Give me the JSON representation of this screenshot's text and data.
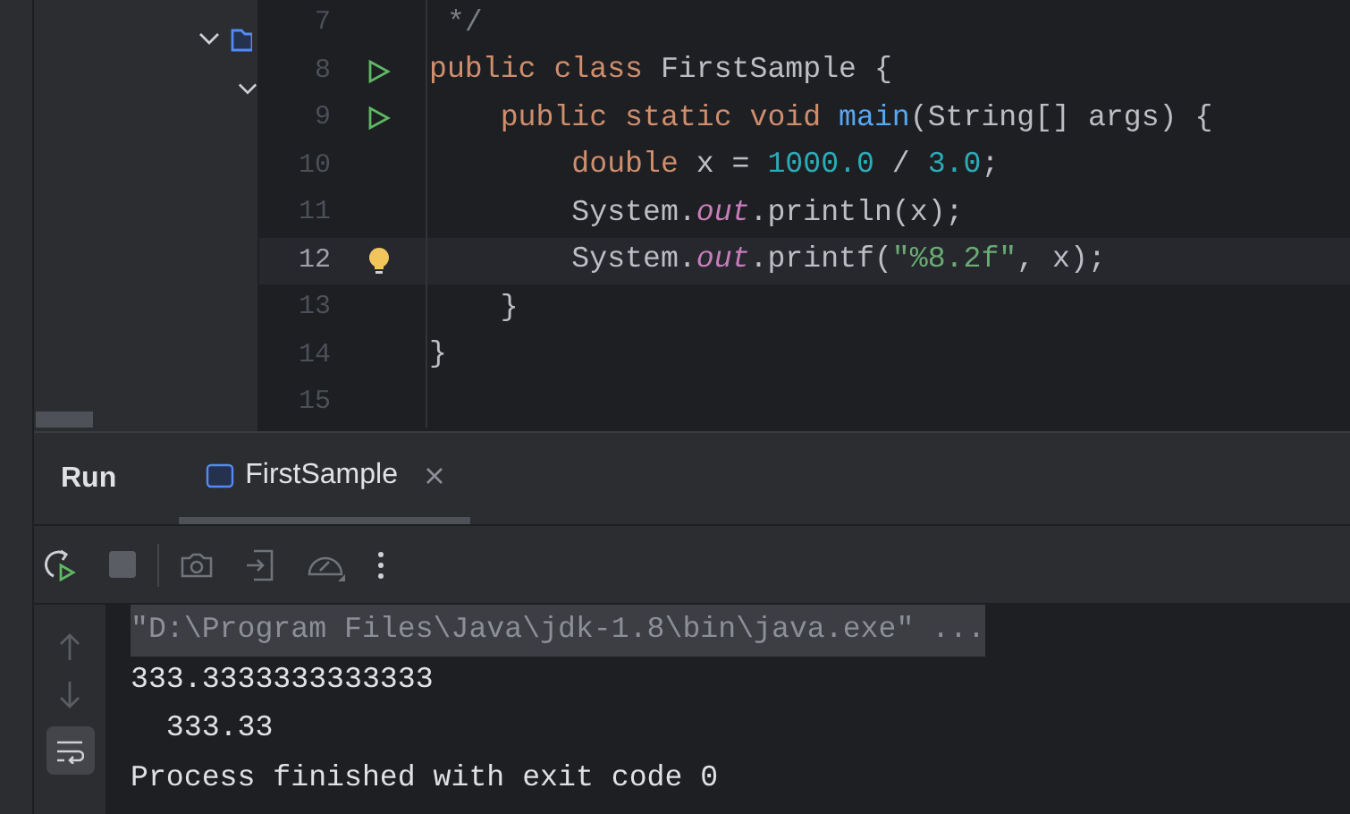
{
  "editor": {
    "lines": [
      {
        "number": "7",
        "run_marker": false,
        "bulb": false,
        "current": false,
        "tokens": [
          {
            "kind": "comment",
            "text": " */"
          }
        ]
      },
      {
        "number": "8",
        "run_marker": true,
        "bulb": false,
        "current": false,
        "tokens": [
          {
            "kind": "keyword",
            "text": "public class "
          },
          {
            "kind": "plain",
            "text": "FirstSample {"
          }
        ]
      },
      {
        "number": "9",
        "run_marker": true,
        "bulb": false,
        "current": false,
        "tokens": [
          {
            "kind": "keyword",
            "text": "    public static void "
          },
          {
            "kind": "method",
            "text": "main"
          },
          {
            "kind": "plain",
            "text": "(String[] args) {"
          }
        ]
      },
      {
        "number": "10",
        "run_marker": false,
        "bulb": false,
        "current": false,
        "tokens": [
          {
            "kind": "keyword",
            "text": "        double "
          },
          {
            "kind": "plain",
            "text": "x = "
          },
          {
            "kind": "number",
            "text": "1000.0"
          },
          {
            "kind": "plain",
            "text": " / "
          },
          {
            "kind": "number",
            "text": "3.0"
          },
          {
            "kind": "plain",
            "text": ";"
          }
        ]
      },
      {
        "number": "11",
        "run_marker": false,
        "bulb": false,
        "current": false,
        "tokens": [
          {
            "kind": "plain",
            "text": "        System."
          },
          {
            "kind": "field",
            "text": "out"
          },
          {
            "kind": "plain",
            "text": ".println(x);"
          }
        ]
      },
      {
        "number": "12",
        "run_marker": false,
        "bulb": true,
        "current": true,
        "tokens": [
          {
            "kind": "plain",
            "text": "        System."
          },
          {
            "kind": "field",
            "text": "out"
          },
          {
            "kind": "plain",
            "text": ".printf("
          },
          {
            "kind": "string",
            "text": "\"%8.2f\""
          },
          {
            "kind": "plain",
            "text": ", x);"
          }
        ]
      },
      {
        "number": "13",
        "run_marker": false,
        "bulb": false,
        "current": false,
        "tokens": [
          {
            "kind": "plain",
            "text": "    }"
          }
        ]
      },
      {
        "number": "14",
        "run_marker": false,
        "bulb": false,
        "current": false,
        "tokens": [
          {
            "kind": "plain",
            "text": "}"
          }
        ]
      },
      {
        "number": "15",
        "run_marker": false,
        "bulb": false,
        "current": false
      }
    ]
  },
  "run_panel": {
    "title": "Run",
    "tabs": [
      {
        "label": "FirstSample",
        "selected": true
      }
    ],
    "soft_wrap": true,
    "console": [
      {
        "kind": "command",
        "text": "\"D:\\Program Files\\Java\\jdk-1.8\\bin\\java.exe\" ..."
      },
      {
        "kind": "output",
        "text": "333.3333333333333"
      },
      {
        "kind": "output",
        "text": "  333.33"
      },
      {
        "kind": "output",
        "text": "Process finished with exit code 0"
      }
    ]
  }
}
